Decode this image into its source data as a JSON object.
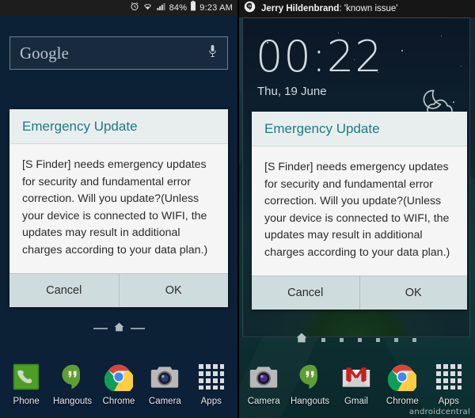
{
  "left_phone": {
    "status_bar": {
      "icons": [
        "alarm-clock-icon",
        "wifi-icon",
        "signal-bars-icon",
        "battery-icon"
      ],
      "battery_percent": "84%",
      "time": "9:23 AM"
    },
    "search_widget": {
      "label": "Google",
      "mic_icon": "microphone-icon"
    },
    "dialog": {
      "title": "Emergency Update",
      "body": "[S Finder] needs emergency updates for security and fundamental error correction. Will you update?(Unless your device is connected to WIFI, the updates may result in additional charges according to your data plan.)",
      "cancel_label": "Cancel",
      "ok_label": "OK"
    },
    "pager": {
      "home_icon": "home-icon",
      "dashes": 2
    },
    "dock": [
      {
        "label": "Phone",
        "icon": "phone-icon"
      },
      {
        "label": "Hangouts",
        "icon": "hangouts-icon"
      },
      {
        "label": "Chrome",
        "icon": "chrome-icon"
      },
      {
        "label": "Camera",
        "icon": "camera-icon"
      },
      {
        "label": "Apps",
        "icon": "apps-grid-icon"
      }
    ]
  },
  "right_phone": {
    "notification": {
      "icon": "hangouts-icon",
      "sender": "Jerry Hildenbrand",
      "message": ": 'known issue'"
    },
    "lockscreen": {
      "time": "00:22",
      "date": "Thu, 19 June",
      "weather_icon": "moon-cloud-icon"
    },
    "dialog": {
      "title": "Emergency Update",
      "body": "[S Finder] needs emergency updates for security and fundamental error correction. Will you update?(Unless your device is connected to WIFI, the updates may result in additional charges according to your data plan.)",
      "cancel_label": "Cancel",
      "ok_label": "OK"
    },
    "pager": {
      "home_icon": "home-icon",
      "dots": 6
    },
    "dock": [
      {
        "label": "Camera",
        "icon": "camera-icon"
      },
      {
        "label": "Hangouts",
        "icon": "hangouts-icon"
      },
      {
        "label": "Gmail",
        "icon": "gmail-icon"
      },
      {
        "label": "Chrome",
        "icon": "chrome-icon"
      },
      {
        "label": "Apps",
        "icon": "apps-grid-icon"
      }
    ],
    "watermark": "androidcentral"
  },
  "colors": {
    "dialog_title": "#1e7a80",
    "dialog_header_bg": "#e8eeee",
    "dialog_body_bg": "#f5f5f5",
    "dialog_button_bg": "#cfdcdd",
    "left_wallpaper": "#0e2840",
    "right_wallpaper": "#0f3a3c",
    "status_bar_bg": "#1d1d1d"
  }
}
